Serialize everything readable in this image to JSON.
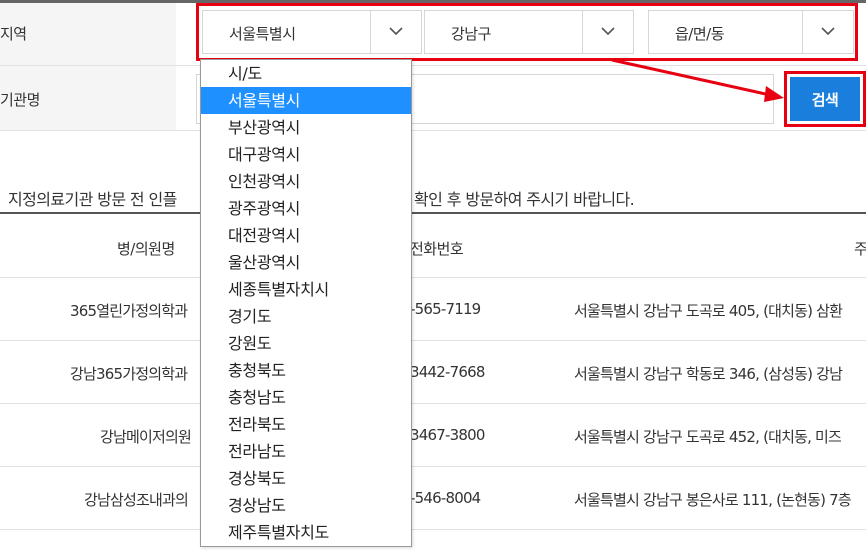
{
  "form": {
    "region_label": "지역",
    "name_label": "기관명",
    "sido_value": "서울특별시",
    "sigungu_value": "강남구",
    "dong_value": "읍/면/동",
    "name_placeholder": "",
    "search_button": "검색"
  },
  "notice": {
    "left": "지정의료기관 방문 전 인플",
    "right": "확인 후 방문하여 주시기 바랍니다."
  },
  "table": {
    "headers": {
      "name": "병/의원명",
      "phone": "전화번호",
      "address": "주"
    },
    "rows": [
      {
        "name": "365열린가정의학과",
        "phone": "-565-7119",
        "address": "서울특별시 강남구 도곡로 405, (대치동) 삼환"
      },
      {
        "name": "강남365가정의학과",
        "phone": "3442-7668",
        "address": "서울특별시 강남구 학동로 346, (삼성동) 강남"
      },
      {
        "name": "강남메이저의원",
        "phone": "3467-3800",
        "address": "서울특별시 강남구 도곡로 452, (대치동, 미즈"
      },
      {
        "name": "강남삼성조내과의",
        "phone": "-546-8004",
        "address": "서울특별시 강남구 봉은사로 111, (논현동) 7층"
      }
    ]
  },
  "dropdown": {
    "selected_index": 1,
    "options": [
      "시/도",
      "서울특별시",
      "부산광역시",
      "대구광역시",
      "인천광역시",
      "광주광역시",
      "대전광역시",
      "울산광역시",
      "세종특별자치시",
      "경기도",
      "강원도",
      "충청북도",
      "충청남도",
      "전라북도",
      "전라남도",
      "경상북도",
      "경상남도",
      "제주특별자치도"
    ]
  },
  "colors": {
    "highlight_red": "#e60012",
    "search_blue": "#1a7fdc",
    "selected_blue": "#1e90ff"
  }
}
